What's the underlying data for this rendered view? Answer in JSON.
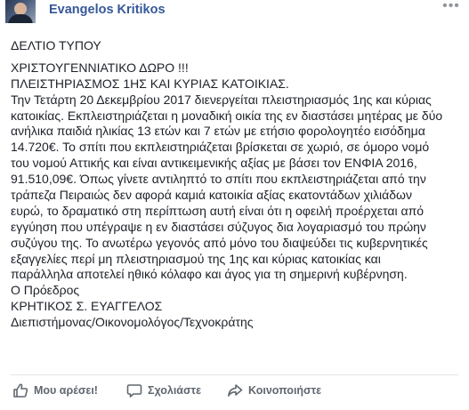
{
  "post": {
    "author": "Evangelos Kritikos",
    "more_icon": "ellipsis-icon",
    "lines": [
      "ΔΕΛΤΙΟ ΤΥΠΟΥ",
      "ΧΡΙΣΤΟΥΓΕΝΝΙΑΤΙΚΟ ΔΩΡΟ !!!",
      "ΠΛΕΙΣΤΗΡΙΑΣΜΟΣ 1ΗΣ ΚΑΙ ΚΥΡΙΑΣ ΚΑΤΟΙΚΙΑΣ.",
      "Την Τετάρτη 20 Δεκεμβρίου 2017 διενεργείται πλειστηριασμός 1ης και κύριας",
      "κατοικίας. Εκπλειστηριάζεται η μοναδική οικία της εν διαστάσει μητέρας με δύο",
      "ανήλικα παιδιά ηλικίας 13 ετών και 7 ετών με ετήσιο φορολογητέο εισόδημα",
      "14.720€. Το σπίτι που εκπλειστηριάζεται βρίσκεται σε χωριό, σε όμορο νομό",
      "του νομού Αττικής και είναι αντικειμενικής αξίας με βάσει τον ΕΝΦΙΑ 2016,",
      "91.510,09€. Όπως γίνετε αντιληπτό το σπίτι που εκπλειστηριάζεται από την",
      "τράπεζα Πειραιώς δεν αφορά καμιά κατοικία αξίας εκατοντάδων χιλιάδων",
      "ευρώ, το δραματικό στη περίπτωση αυτή είναι ότι η οφειλή προέρχεται από",
      "εγγύηση που υπέγραψε η εν διαστάσει σύζυγος δια λογαριασμό του πρώην",
      "συζύγου της. Το ανωτέρω γεγονός από μόνο του διαψεύδει τις κυβερνητικές",
      "εξαγγελίες περί μη πλειστηριασμού της 1ης και κύριας κατοικίας και",
      "παράλληλα αποτελεί ηθικό κόλαφο και άγος για τη σημερινή κυβέρνηση.",
      "Ο Πρόεδρος",
      "ΚΡΗΤΙΚΟΣ Σ. ΕΥΑΓΓΕΛΟΣ",
      "Διεπιστήμονας/Οικονομολόγος/Τεχνοκράτης"
    ]
  },
  "actions": {
    "like_label": "Μου αρέσει!",
    "comment_label": "Σχολιάστε",
    "share_label": "Κοινοποιήστε",
    "like_icon": "thumbs-up-icon",
    "comment_icon": "comment-icon",
    "share_icon": "share-icon"
  },
  "colors": {
    "author_link": "#365899",
    "text": "#1d2129",
    "action_text": "#606770",
    "divider": "#e5e5e5"
  }
}
